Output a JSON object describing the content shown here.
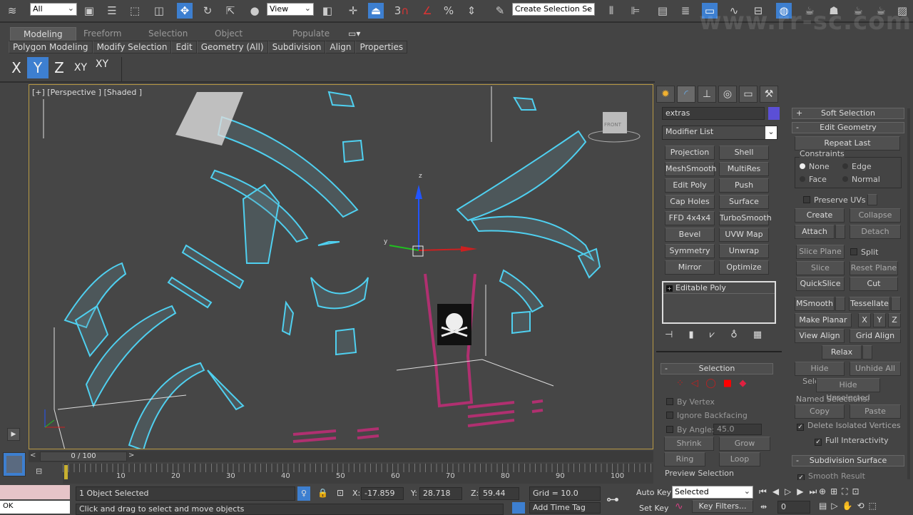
{
  "toolbar": {
    "selection_filter": "All",
    "reference_coord": "View",
    "named_selection": "Create Selection Se",
    "snap_label": "3",
    "watermark": "www.rr-sc.com"
  },
  "ribbon": {
    "tabs": [
      "Modeling",
      "Freeform",
      "Selection",
      "Object Paint",
      "Populate"
    ],
    "items": [
      "Polygon Modeling",
      "Modify Selection",
      "Edit",
      "Geometry (All)",
      "Subdivision",
      "Align",
      "Properties"
    ]
  },
  "axis_constraints": {
    "items": [
      "X",
      "Y",
      "Z",
      "XY",
      "XY"
    ],
    "active": "Y"
  },
  "viewport": {
    "label": "[+] [Perspective ] [Shaded ]",
    "gizmo_labels": {
      "x": "x",
      "y": "y",
      "z": "z"
    },
    "viewcube_label": "FRONT"
  },
  "command_panel": {
    "object_name": "extras",
    "object_color": "#5b4fd6",
    "modifier_list": "Modifier List",
    "modifier_buttons": [
      "Projection",
      "Shell",
      "MeshSmooth",
      "MultiRes",
      "Edit Poly",
      "Push",
      "Cap Holes",
      "Surface",
      "FFD 4x4x4",
      "TurboSmooth",
      "Bevel",
      "UVW Map",
      "Symmetry",
      "Unwrap UVW",
      "Mirror",
      "Optimize"
    ],
    "stack": [
      "Editable Poly"
    ],
    "selection": {
      "title": "Selection",
      "by_vertex": "By Vertex",
      "ignore_backfacing": "Ignore Backfacing",
      "by_angle": "By Angle:",
      "angle_value": "45.0",
      "shrink": "Shrink",
      "grow": "Grow",
      "ring": "Ring",
      "loop": "Loop",
      "preview": "Preview Selection"
    },
    "soft_selection": "Soft Selection",
    "edit_geometry": {
      "title": "Edit Geometry",
      "repeat_last": "Repeat Last",
      "constraints": "Constraints",
      "none": "None",
      "edge": "Edge",
      "face": "Face",
      "normal": "Normal",
      "preserve_uvs": "Preserve UVs",
      "create": "Create",
      "collapse": "Collapse",
      "attach": "Attach",
      "detach": "Detach",
      "slice_plane": "Slice Plane",
      "split": "Split",
      "slice": "Slice",
      "reset_plane": "Reset Plane",
      "quickslice": "QuickSlice",
      "cut": "Cut",
      "msmooth": "MSmooth",
      "tessellate": "Tessellate",
      "make_planar": "Make Planar",
      "x": "X",
      "y": "Y",
      "z": "Z",
      "view_align": "View Align",
      "grid_align": "Grid Align",
      "relax": "Relax",
      "hide_selected": "Hide Selected",
      "unhide_all": "Unhide All",
      "hide_unselected": "Hide Unselected",
      "named_selections": "Named Selections:",
      "copy": "Copy",
      "paste": "Paste",
      "delete_isolated": "Delete Isolated Vertices",
      "full_interactivity": "Full Interactivity"
    },
    "subdivision_surface": {
      "title": "Subdivision Surface",
      "smooth_result": "Smooth Result"
    }
  },
  "timeline": {
    "frame": "0 / 100",
    "ticks": [
      "10",
      "20",
      "30",
      "40",
      "50",
      "60",
      "70",
      "80",
      "90",
      "100"
    ],
    "progress": 0
  },
  "status": {
    "selected": "1 Object Selected",
    "prompt": "Click and drag to select and move objects",
    "x_label": "X:",
    "x": "-17.859",
    "y_label": "Y:",
    "y": "28.718",
    "z_label": "Z:",
    "z": "59.44",
    "grid": "Grid = 10.0",
    "add_time_tag": "Add Time Tag",
    "auto_key": "Auto Key",
    "set_key": "Set Key",
    "key_mode": "Selected",
    "key_filters": "Key Filters...",
    "current_frame": "0",
    "maxscript_output": "OK"
  }
}
